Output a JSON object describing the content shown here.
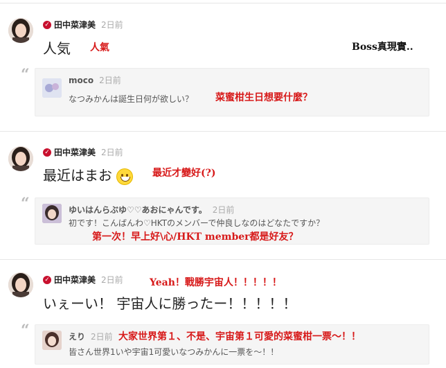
{
  "author_name": "田中菜津美",
  "posts": [
    {
      "time": "2日前",
      "text": "人気",
      "annotation": "人氣",
      "annotation_right": "Boss真現實..",
      "reply": {
        "name": "moco",
        "time": "2日前",
        "text": "なつみかんは誕生日何が欲しい？",
        "annotation": "菜蜜柑生日想要什麼？"
      }
    },
    {
      "time": "2日前",
      "text": "最近はまお",
      "emoji": "smile-emoji",
      "annotation": "最近才變好(?)",
      "reply": {
        "name": "ゆいはんらぶゆ♡♡あおにゃんです。",
        "time": "2日前",
        "text": "初です！こんばんわ♡HKTのメンバーで仲良しなのはどなたですか？",
        "annotation": "第一次！早上好\\心/HKT member都是好友？"
      }
    },
    {
      "time": "2日前",
      "text": "いぇーい！ 宇宙人に勝ったー！！！！！",
      "annotation": "Yeah！戰勝宇宙人！！！！！",
      "reply": {
        "name": "えり",
        "time": "2日前",
        "text": "皆さん世界1いや宇宙1可愛いなつみかんに一票を～！！",
        "annotation": "大家世界第１、不是、宇宙第１可愛的菜蜜柑一票～！！"
      }
    }
  ],
  "colors": {
    "accent": "#d71919",
    "verified": "#c8102e",
    "reply_bg": "#f5f5f5"
  }
}
